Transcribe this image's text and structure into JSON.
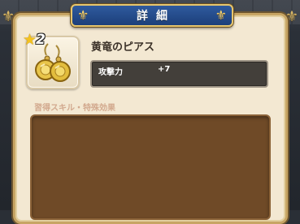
{
  "header": {
    "title": "詳細"
  },
  "item": {
    "stars": "2",
    "name": "黄竜のピアス",
    "icon": "gold-earrings-icon",
    "stat_label": "攻撃力",
    "stat_value": "+7"
  },
  "skills": {
    "title": "習得スキル・特殊効果"
  },
  "colors": {
    "header_blue": "#1c3f7a",
    "panel_bg": "#f3e8d2",
    "gold_trim": "#c7a564",
    "skills_box": "#6f4a27",
    "stat_box": "#433f3a"
  }
}
